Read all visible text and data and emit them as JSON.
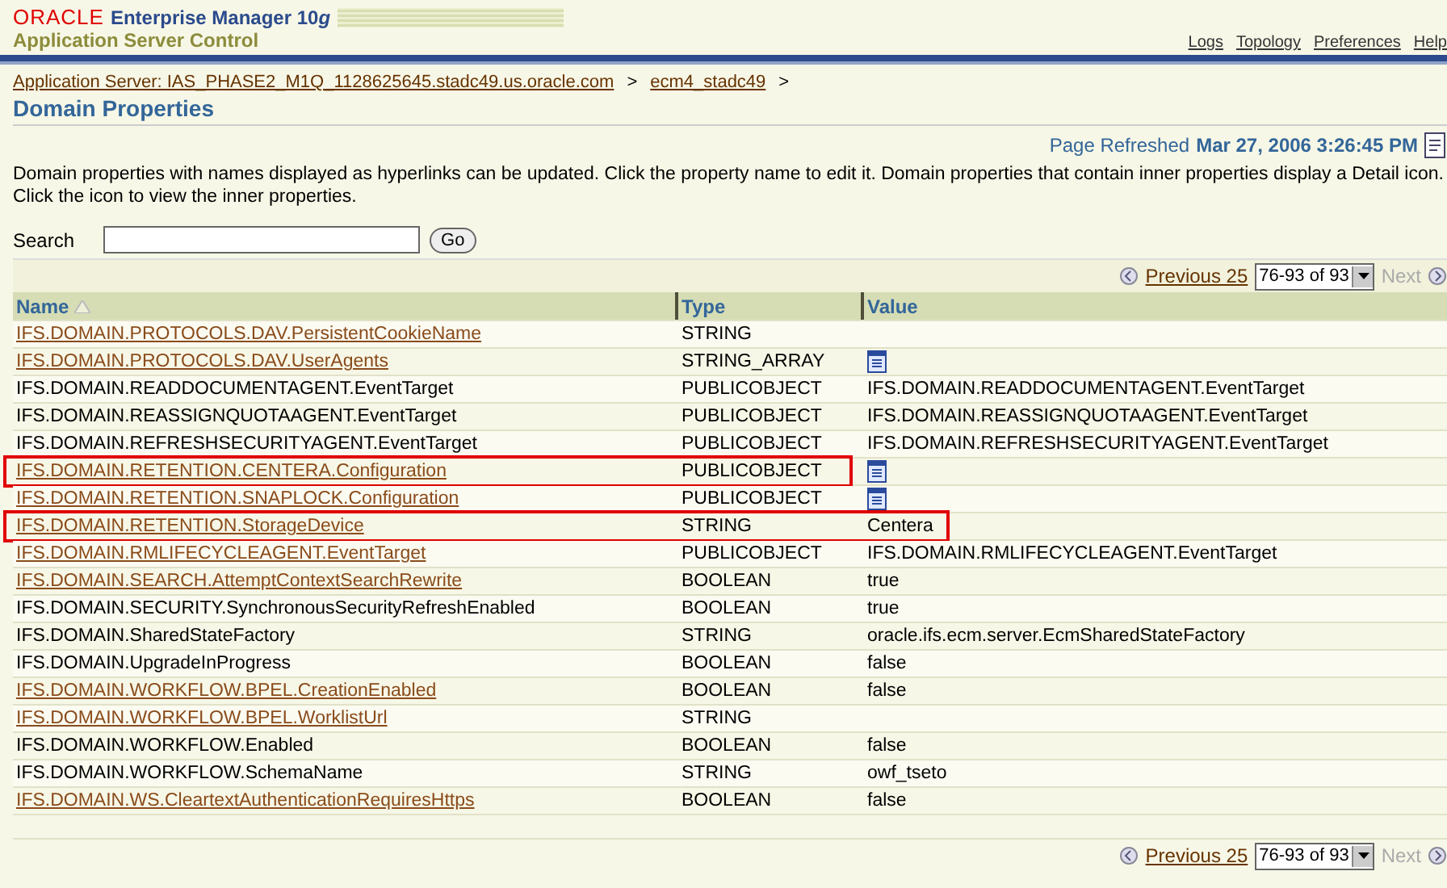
{
  "header": {
    "brand": "ORACLE",
    "product": "Enterprise Manager 10",
    "product_suffix": "g",
    "subtitle": "Application Server Control",
    "links": [
      "Logs",
      "Topology",
      "Preferences",
      "Help"
    ]
  },
  "breadcrumb": [
    "Application Server: IAS_PHASE2_M1Q_1128625645.stadc49.us.oracle.com",
    ">",
    "ecm4_stadc49",
    ">"
  ],
  "page_title": "Domain Properties",
  "refreshed": {
    "label": "Page Refreshed",
    "value": "Mar 27, 2006 3:26:45 PM"
  },
  "description": "Domain properties with names displayed as hyperlinks can be updated. Click the property name to edit it. Domain properties that contain inner properties display a Detail icon. Click the icon to view the inner properties.",
  "search": {
    "label": "Search",
    "button": "Go"
  },
  "pagination": {
    "previous": "Previous 25",
    "range": "76-93 of 93",
    "next": "Next"
  },
  "table": {
    "columns": [
      "Name",
      "Type",
      "Value"
    ],
    "rows": [
      {
        "name": "IFS.DOMAIN.PROTOCOLS.DAV.PersistentCookieName",
        "link": true,
        "type": "STRING",
        "details": false,
        "highlighted": false
      },
      {
        "name": "IFS.DOMAIN.PROTOCOLS.DAV.UserAgents",
        "link": true,
        "type": "STRING_ARRAY",
        "details": true,
        "highlighted": false
      },
      {
        "name": "IFS.DOMAIN.READDOCUMENTAGENT.EventTarget",
        "link": false,
        "type": "PUBLICOBJECT",
        "details": false,
        "value": "IFS.DOMAIN.READDOCUMENTAGENT.EventTarget",
        "highlighted": false
      },
      {
        "name": "IFS.DOMAIN.REASSIGNQUOTAAGENT.EventTarget",
        "link": false,
        "type": "PUBLICOBJECT",
        "details": false,
        "value": "IFS.DOMAIN.REASSIGNQUOTAAGENT.EventTarget",
        "highlighted": false
      },
      {
        "name": "IFS.DOMAIN.REFRESHSECURITYAGENT.EventTarget",
        "link": false,
        "type": "PUBLICOBJECT",
        "details": false,
        "value": "IFS.DOMAIN.REFRESHSECURITYAGENT.EventTarget",
        "highlighted": false
      },
      {
        "name": "IFS.DOMAIN.RETENTION.CENTERA.Configuration",
        "link": true,
        "type": "PUBLICOBJECT",
        "details": true,
        "highlighted": true
      },
      {
        "name": "IFS.DOMAIN.RETENTION.SNAPLOCK.Configuration",
        "link": true,
        "type": "PUBLICOBJECT",
        "details": true,
        "highlighted": false
      },
      {
        "name": "IFS.DOMAIN.RETENTION.StorageDevice",
        "link": true,
        "type": "STRING",
        "details": false,
        "value": "Centera",
        "highlighted": true
      },
      {
        "name": "IFS.DOMAIN.RMLIFECYCLEAGENT.EventTarget",
        "link": true,
        "type": "PUBLICOBJECT",
        "details": false,
        "value": "IFS.DOMAIN.RMLIFECYCLEAGENT.EventTarget",
        "highlighted": false
      },
      {
        "name": "IFS.DOMAIN.SEARCH.AttemptContextSearchRewrite",
        "link": true,
        "type": "BOOLEAN",
        "details": false,
        "value": "true",
        "highlighted": false
      },
      {
        "name": "IFS.DOMAIN.SECURITY.SynchronousSecurityRefreshEnabled",
        "link": false,
        "type": "BOOLEAN",
        "details": false,
        "value": "true",
        "highlighted": false
      },
      {
        "name": "IFS.DOMAIN.SharedStateFactory",
        "link": false,
        "type": "STRING",
        "details": false,
        "value": "oracle.ifs.ecm.server.EcmSharedStateFactory",
        "highlighted": false
      },
      {
        "name": "IFS.DOMAIN.UpgradeInProgress",
        "link": false,
        "type": "BOOLEAN",
        "details": false,
        "value": "false",
        "highlighted": false
      },
      {
        "name": "IFS.DOMAIN.WORKFLOW.BPEL.CreationEnabled",
        "link": true,
        "type": "BOOLEAN",
        "details": false,
        "value": "false",
        "highlighted": false
      },
      {
        "name": "IFS.DOMAIN.WORKFLOW.BPEL.WorklistUrl",
        "link": true,
        "type": "STRING",
        "details": false,
        "highlighted": false
      },
      {
        "name": "IFS.DOMAIN.WORKFLOW.Enabled",
        "link": false,
        "type": "BOOLEAN",
        "details": false,
        "value": "false",
        "highlighted": false
      },
      {
        "name": "IFS.DOMAIN.WORKFLOW.SchemaName",
        "link": false,
        "type": "STRING",
        "details": false,
        "value": "owf_tseto",
        "highlighted": false
      },
      {
        "name": "IFS.DOMAIN.WS.CleartextAuthenticationRequiresHttps",
        "link": true,
        "type": "BOOLEAN",
        "details": false,
        "value": "false",
        "highlighted": false
      }
    ]
  },
  "bottom_pagination": {
    "previous": "Previous 25",
    "range": "76-93 of 93",
    "next": "Next"
  }
}
